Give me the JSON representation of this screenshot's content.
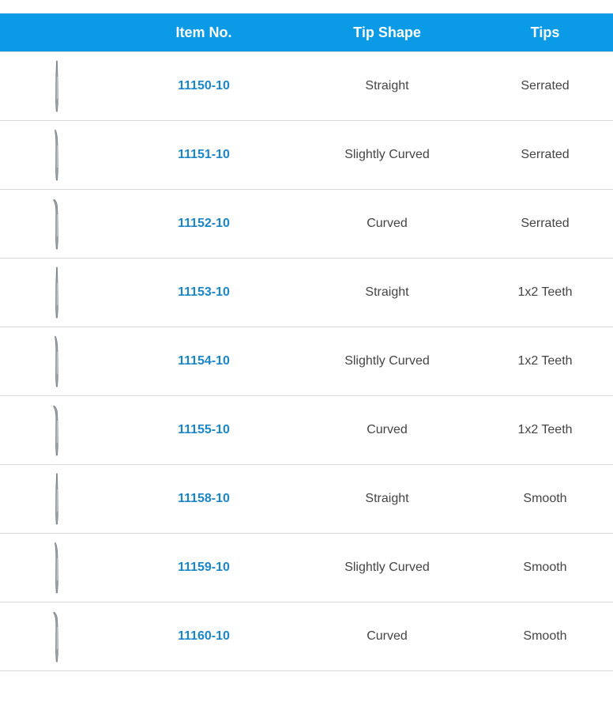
{
  "header": {
    "image_col": "",
    "item_no": "Item No.",
    "tip_shape": "Tip Shape",
    "tips": "Tips"
  },
  "rows": [
    {
      "item_no": "11150-10",
      "tip_shape": "Straight",
      "tips": "Serrated",
      "icon": "straight-forceps-icon"
    },
    {
      "item_no": "11151-10",
      "tip_shape": "Slightly Curved",
      "tips": "Serrated",
      "icon": "slightly-curved-forceps-icon"
    },
    {
      "item_no": "11152-10",
      "tip_shape": "Curved",
      "tips": "Serrated",
      "icon": "curved-forceps-icon"
    },
    {
      "item_no": "11153-10",
      "tip_shape": "Straight",
      "tips": "1x2 Teeth",
      "icon": "straight-forceps-icon"
    },
    {
      "item_no": "11154-10",
      "tip_shape": "Slightly Curved",
      "tips": "1x2 Teeth",
      "icon": "slightly-curved-forceps-icon"
    },
    {
      "item_no": "11155-10",
      "tip_shape": "Curved",
      "tips": "1x2 Teeth",
      "icon": "curved-forceps-icon"
    },
    {
      "item_no": "11158-10",
      "tip_shape": "Straight",
      "tips": "Smooth",
      "icon": "straight-forceps-icon"
    },
    {
      "item_no": "11159-10",
      "tip_shape": "Slightly Curved",
      "tips": "Smooth",
      "icon": "slightly-curved-forceps-icon"
    },
    {
      "item_no": "11160-10",
      "tip_shape": "Curved",
      "tips": "Smooth",
      "icon": "curved-forceps-icon"
    }
  ],
  "colors": {
    "header_bg": "#0a9ae6",
    "item_link": "#1a86c7",
    "text": "#444444",
    "divider": "#d8d8d8"
  }
}
